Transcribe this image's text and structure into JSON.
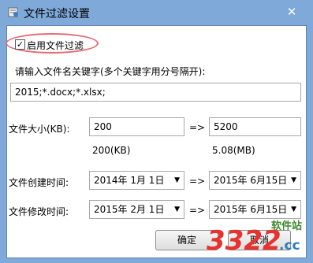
{
  "window": {
    "title": "文件过滤设置",
    "close_glyph": "✕"
  },
  "filter": {
    "enable_checked": true,
    "enable_label": "启用文件过滤",
    "keywords_label": "请输入文件名关键字(多个关键字用分号隔开):",
    "keywords_value": "2015;*.docx;*.xlsx;"
  },
  "size": {
    "label": "文件大小(KB):",
    "min": "200",
    "arrow": "=>",
    "max": "5200",
    "min_hint": "200(KB)",
    "max_hint": "5.08(MB)"
  },
  "created": {
    "label": "文件创建时间:",
    "from": "2014年  1月  1日",
    "arrow": "=>",
    "to": "2015年  6月15日"
  },
  "modified": {
    "label": "文件修改时间:",
    "from": "2015年  2月  1日",
    "arrow": "=>",
    "to": "2015年  6月15日"
  },
  "buttons": {
    "ok": "确定",
    "cancel": "取消"
  },
  "watermark": {
    "brand": "软件站",
    "number": "3322",
    "domain": ".cc"
  },
  "colors": {
    "title_bg": "#7fa9d8",
    "highlight": "#e46a74",
    "watermark_red": "#e8322f"
  }
}
